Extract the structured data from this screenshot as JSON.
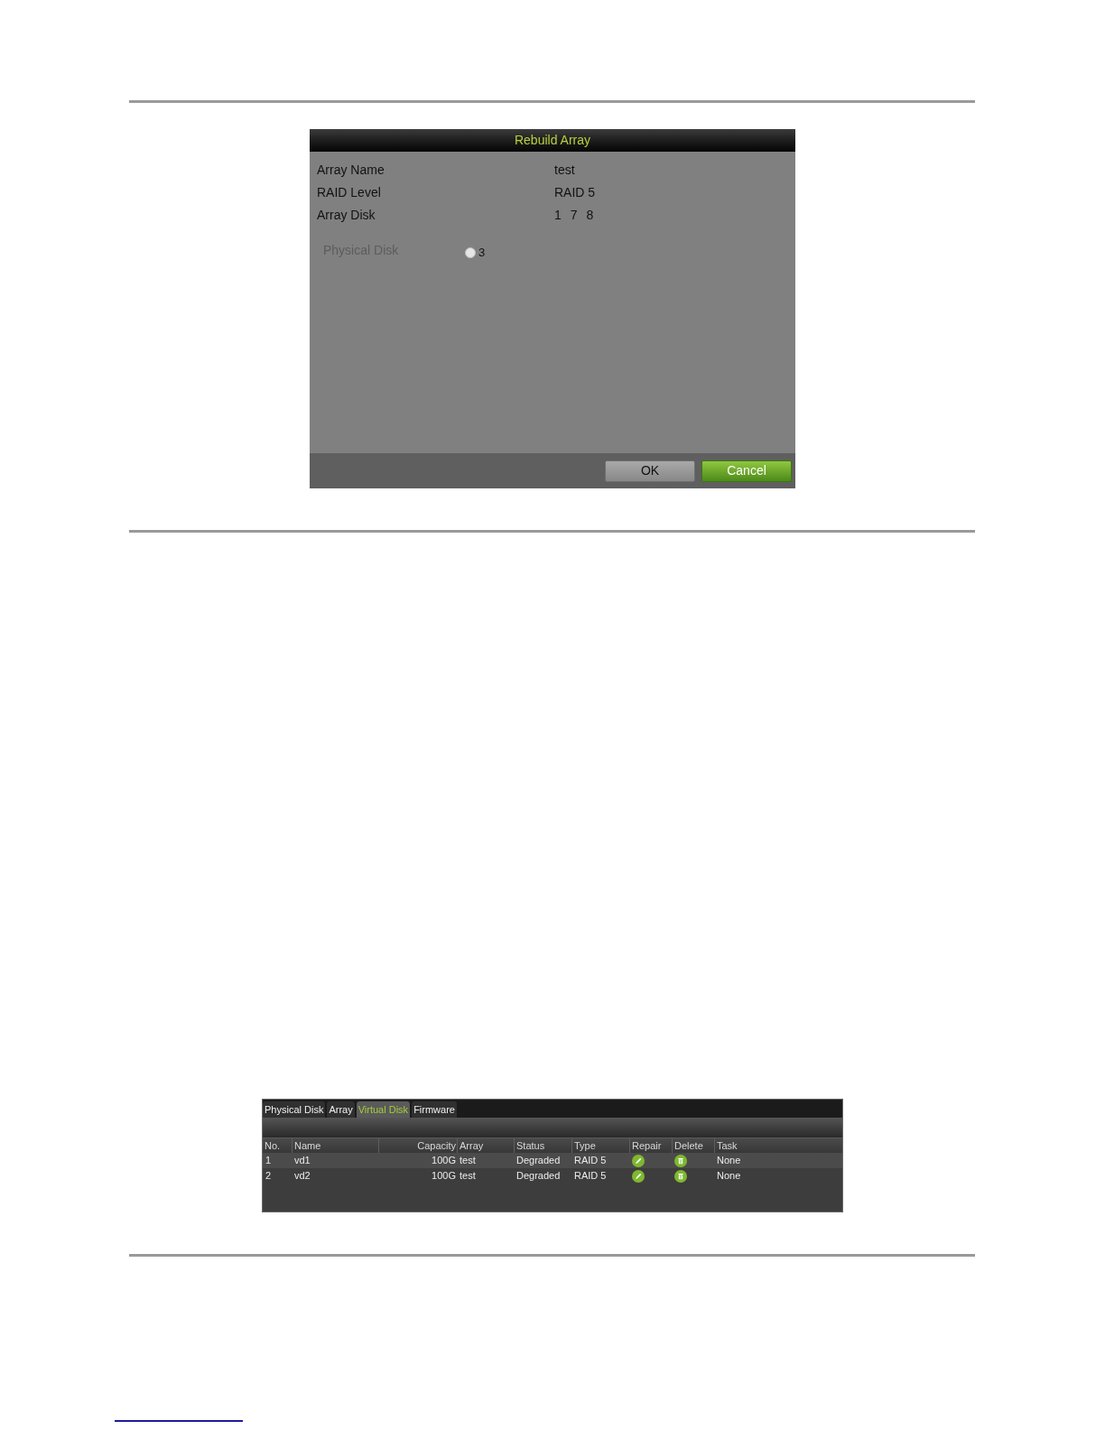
{
  "dialog": {
    "title": "Rebuild Array",
    "fields": [
      {
        "label": "Array Name",
        "value": "test"
      },
      {
        "label": "RAID Level",
        "value": "RAID 5"
      },
      {
        "label": "Array Disk",
        "disks": [
          "1",
          "7",
          "8"
        ]
      }
    ],
    "physical_disk": {
      "label": "Physical Disk",
      "options": [
        {
          "label": "3",
          "selected": false
        }
      ]
    },
    "buttons": [
      {
        "label": "OK",
        "kind": "default"
      },
      {
        "label": "Cancel",
        "kind": "primary"
      }
    ]
  },
  "raid_panel": {
    "tabs": [
      {
        "label": "Physical Disk",
        "selected": false
      },
      {
        "label": "Array",
        "selected": false
      },
      {
        "label": "Virtual Disk",
        "selected": true
      },
      {
        "label": "Firmware",
        "selected": false
      }
    ],
    "table": {
      "columns": [
        {
          "label": "No.",
          "kind": "text"
        },
        {
          "label": "Name",
          "kind": "text"
        },
        {
          "label": "Capacity",
          "kind": "number"
        },
        {
          "label": "Array",
          "kind": "text"
        },
        {
          "label": "Status",
          "kind": "text"
        },
        {
          "label": "Type",
          "kind": "text"
        },
        {
          "label": "Repair",
          "kind": "text"
        },
        {
          "label": "Delete",
          "kind": "text"
        },
        {
          "label": "Task",
          "kind": "text"
        }
      ],
      "rows": [
        {
          "selected": true,
          "cells": [
            {
              "kind": "text",
              "text": "1"
            },
            {
              "kind": "text",
              "text": "vd1"
            },
            {
              "kind": "number",
              "text": "100G"
            },
            {
              "kind": "text",
              "text": "test"
            },
            {
              "kind": "text",
              "text": "Degraded"
            },
            {
              "kind": "text",
              "text": "RAID 5"
            },
            {
              "kind": "repair"
            },
            {
              "kind": "delete"
            },
            {
              "kind": "text",
              "text": "None"
            }
          ]
        },
        {
          "selected": false,
          "cells": [
            {
              "kind": "text",
              "text": "2"
            },
            {
              "kind": "text",
              "text": "vd2"
            },
            {
              "kind": "number",
              "text": "100G"
            },
            {
              "kind": "text",
              "text": "test"
            },
            {
              "kind": "text",
              "text": "Degraded"
            },
            {
              "kind": "text",
              "text": "RAID 5"
            },
            {
              "kind": "repair"
            },
            {
              "kind": "delete"
            },
            {
              "kind": "text",
              "text": "None"
            }
          ]
        }
      ]
    }
  }
}
